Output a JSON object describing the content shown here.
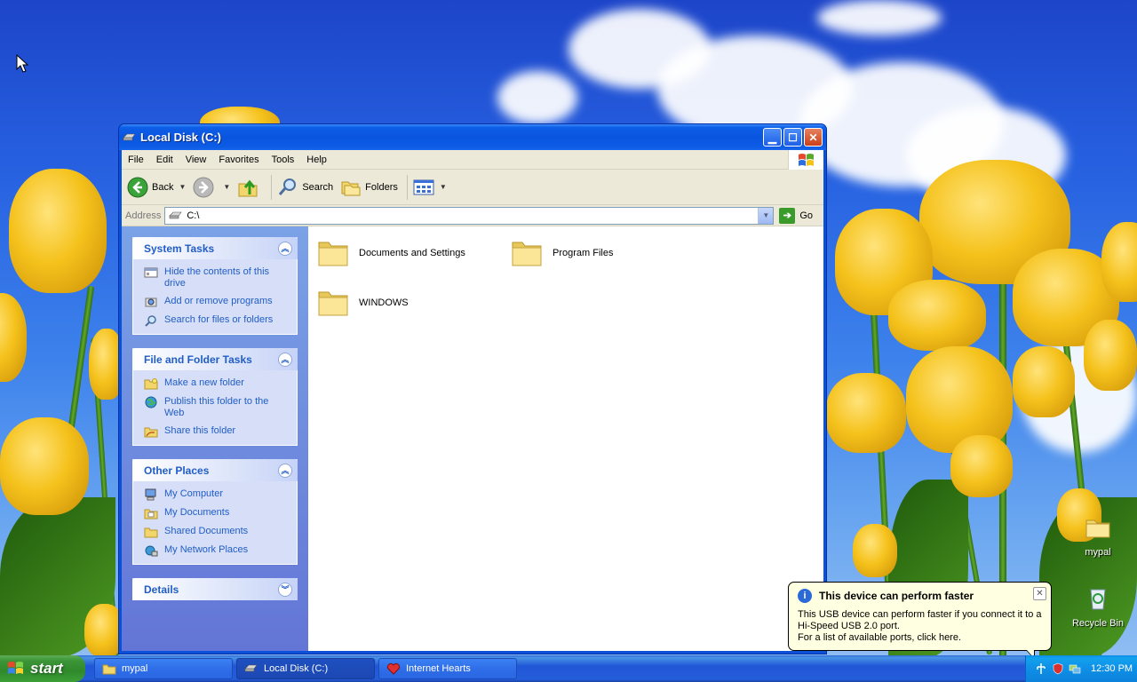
{
  "window": {
    "title": "Local Disk (C:)",
    "menu": [
      "File",
      "Edit",
      "View",
      "Favorites",
      "Tools",
      "Help"
    ],
    "toolbar": {
      "back": "Back",
      "search": "Search",
      "folders": "Folders"
    },
    "address": {
      "label": "Address",
      "value": "C:\\",
      "go": "Go"
    }
  },
  "taskpane": {
    "system_tasks": {
      "title": "System Tasks",
      "items": [
        "Hide the contents of this drive",
        "Add or remove programs",
        "Search for files or folders"
      ]
    },
    "file_folder_tasks": {
      "title": "File and Folder Tasks",
      "items": [
        "Make a new folder",
        "Publish this folder to the Web",
        "Share this folder"
      ]
    },
    "other_places": {
      "title": "Other Places",
      "items": [
        "My Computer",
        "My Documents",
        "Shared Documents",
        "My Network Places"
      ]
    },
    "details": {
      "title": "Details"
    }
  },
  "files": [
    "Documents and Settings",
    "Program Files",
    "WINDOWS"
  ],
  "desktop_icons": {
    "mypal": "mypal",
    "recycle": "Recycle Bin"
  },
  "balloon": {
    "title": "This device can perform faster",
    "line1": "This USB device can perform faster if you connect it to a Hi-Speed USB 2.0 port.",
    "line2": "For a list of available ports, click here."
  },
  "taskbar": {
    "start": "start",
    "buttons": [
      "mypal",
      "Local Disk (C:)",
      "Internet Hearts"
    ],
    "clock": "12:30 PM"
  }
}
